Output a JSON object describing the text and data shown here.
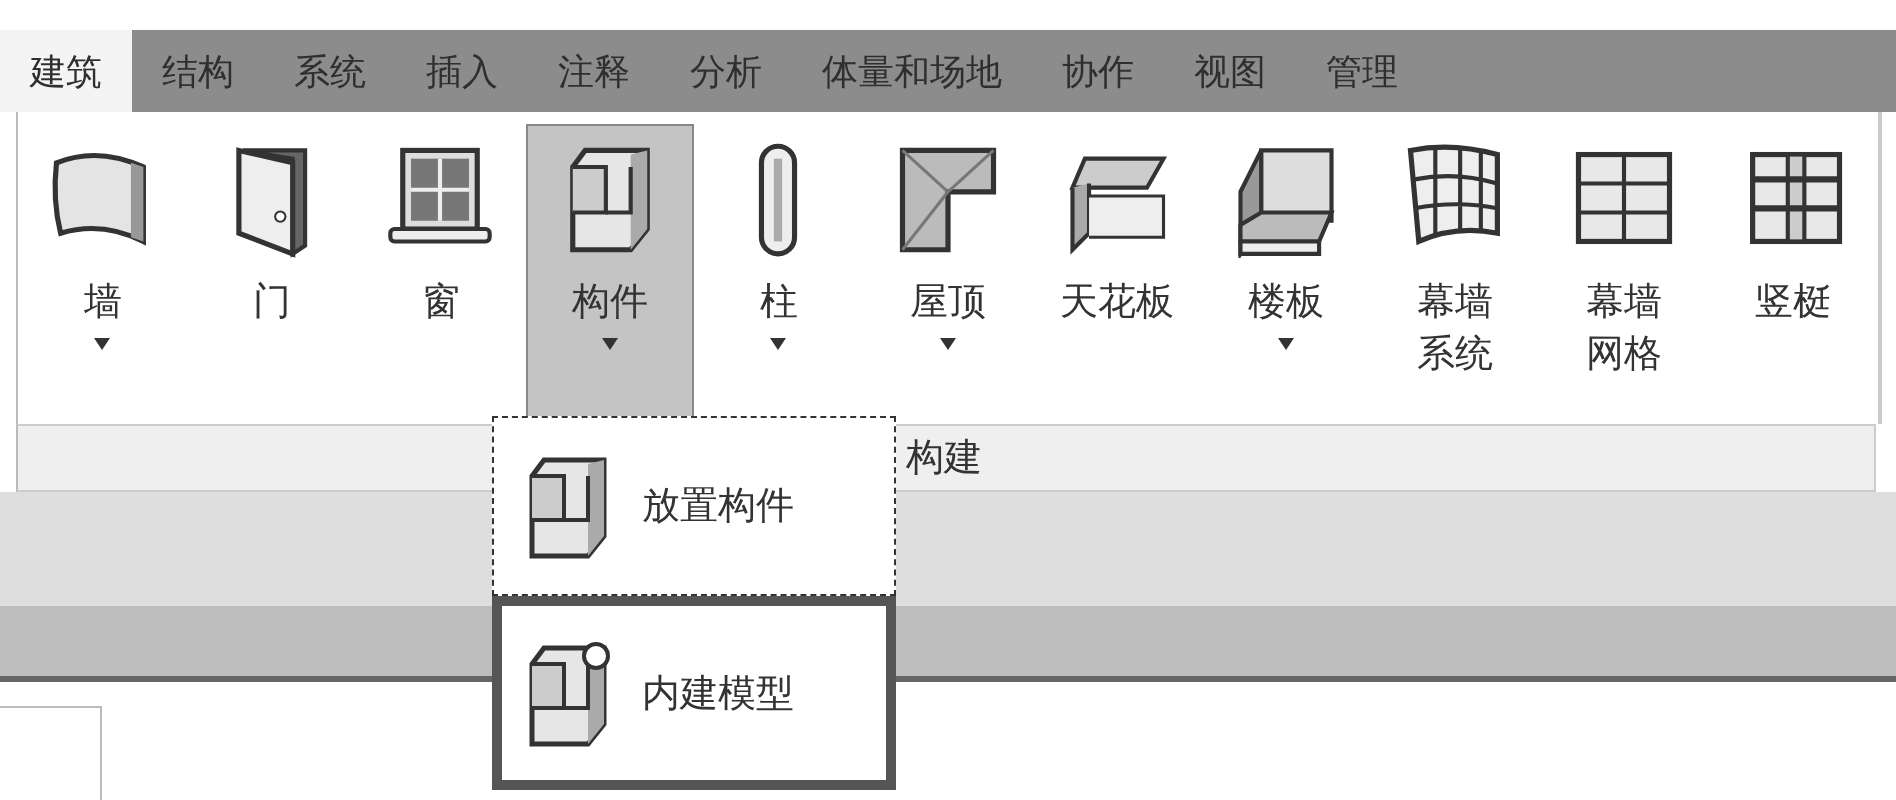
{
  "tabs": [
    {
      "label": "建筑",
      "selected": true
    },
    {
      "label": "结构",
      "selected": false
    },
    {
      "label": "系统",
      "selected": false
    },
    {
      "label": "插入",
      "selected": false
    },
    {
      "label": "注释",
      "selected": false
    },
    {
      "label": "分析",
      "selected": false
    },
    {
      "label": "体量和场地",
      "selected": false
    },
    {
      "label": "协作",
      "selected": false
    },
    {
      "label": "视图",
      "selected": false
    },
    {
      "label": "管理",
      "selected": false
    }
  ],
  "panel": {
    "label": "构建",
    "buttons": [
      {
        "label": "墙",
        "dropdown": true,
        "selected": false
      },
      {
        "label": "门",
        "dropdown": false,
        "selected": false
      },
      {
        "label": "窗",
        "dropdown": false,
        "selected": false
      },
      {
        "label": "构件",
        "dropdown": true,
        "selected": true
      },
      {
        "label": "柱",
        "dropdown": true,
        "selected": false
      },
      {
        "label": "屋顶",
        "dropdown": true,
        "selected": false
      },
      {
        "label": "天花板",
        "dropdown": false,
        "selected": false
      },
      {
        "label": "楼板",
        "dropdown": true,
        "selected": false
      },
      {
        "label": "幕墙系统",
        "dropdown": false,
        "selected": false
      },
      {
        "label": "幕墙网格",
        "dropdown": false,
        "selected": false
      },
      {
        "label": "竖梃",
        "dropdown": false,
        "selected": false
      }
    ]
  },
  "menu": {
    "items": [
      {
        "label": "放置构件",
        "selected": false
      },
      {
        "label": "内建模型",
        "selected": true
      }
    ]
  }
}
